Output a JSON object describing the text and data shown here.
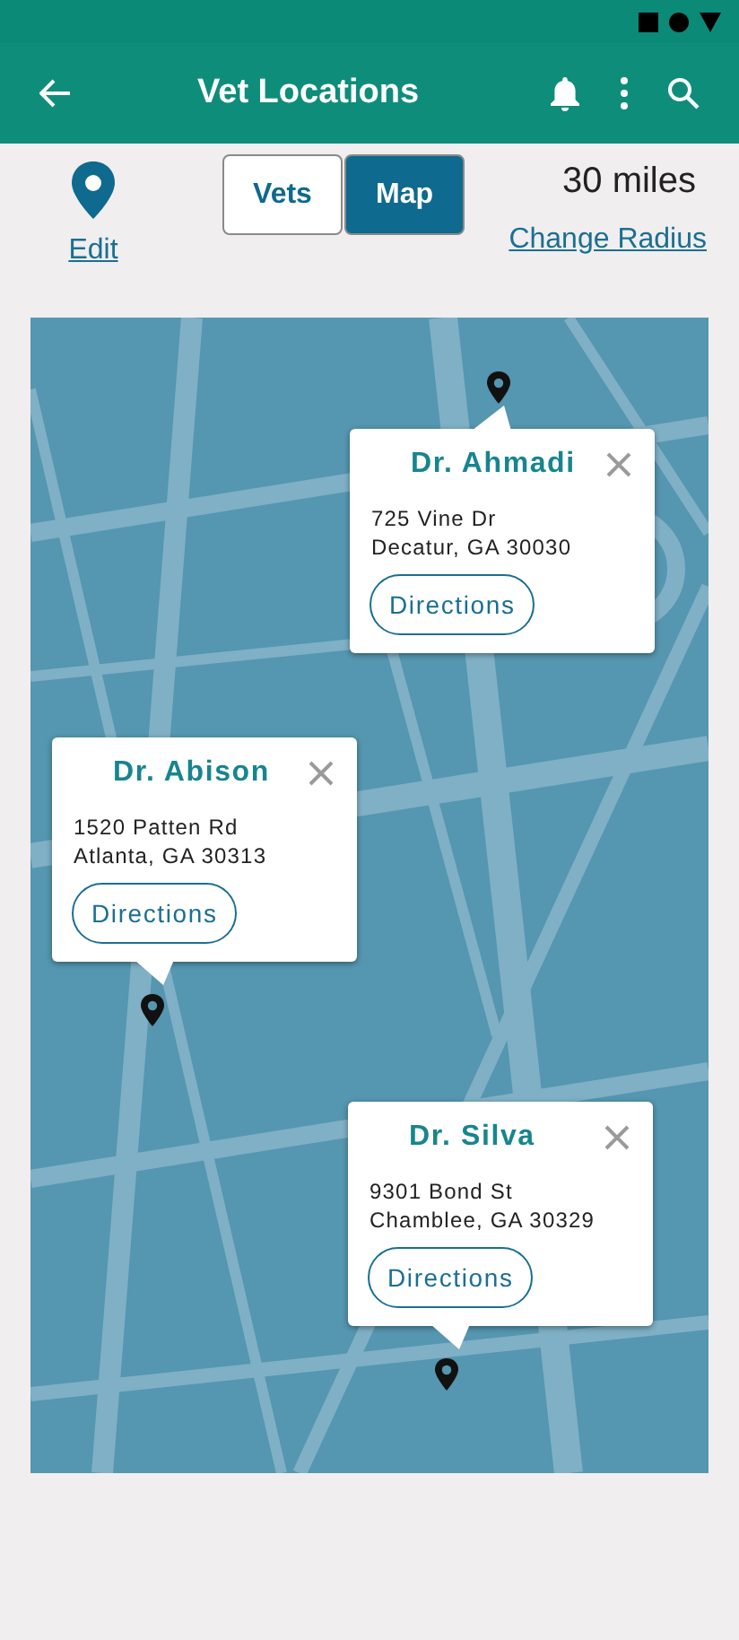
{
  "app_bar": {
    "title": "Vet Locations"
  },
  "location": {
    "edit_link": "Edit"
  },
  "tabs": [
    {
      "label": "Vets",
      "selected": false
    },
    {
      "label": "Map",
      "selected": true
    }
  ],
  "radius": {
    "value": "30 miles",
    "link": "Change Radius"
  },
  "map": {
    "popups": [
      {
        "name": "Dr. Ahmadi",
        "address_line_1": "725 Vine Dr",
        "address_line_2": "Decatur, GA 30030",
        "button": "Directions"
      },
      {
        "name": "Dr. Abison",
        "address_line_1": "1520 Patten Rd",
        "address_line_2": "Atlanta, GA 30313",
        "button": "Directions"
      },
      {
        "name": "Dr. Silva",
        "address_line_1": "9301 Bond St",
        "address_line_2": "Chamblee, GA 30329",
        "button": "Directions"
      }
    ]
  }
}
